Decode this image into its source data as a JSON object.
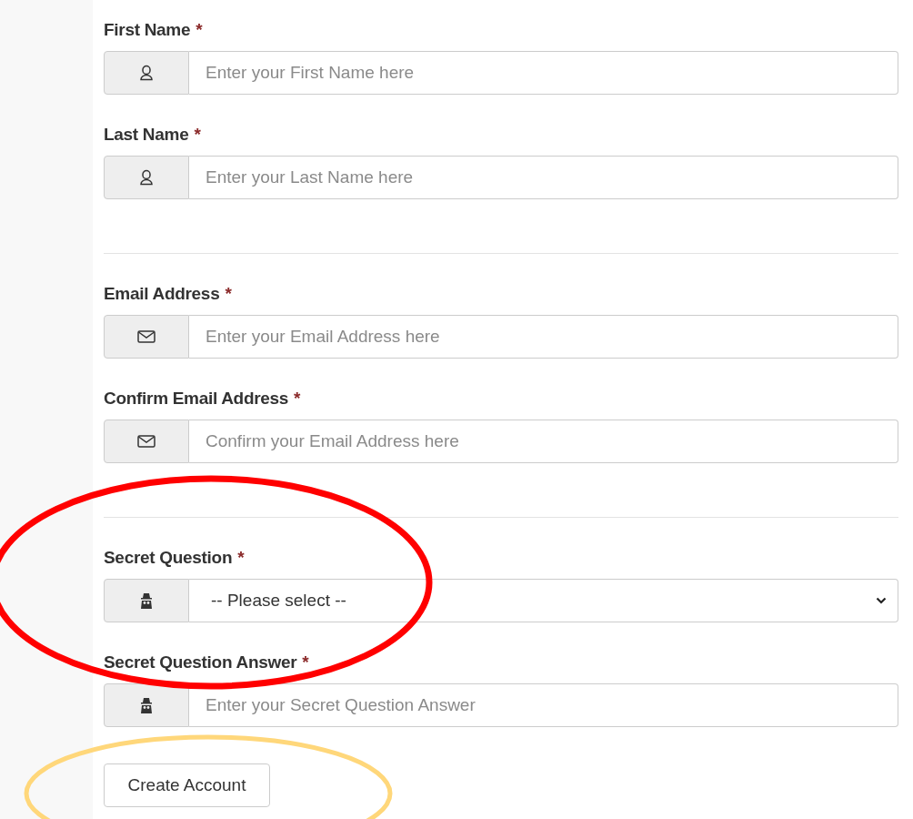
{
  "sections": [
    {
      "fields": [
        {
          "label": "First Name",
          "required": "*",
          "kind": "input",
          "placeholder": "Enter your First Name here"
        },
        {
          "label": "Last Name",
          "required": "*",
          "kind": "input",
          "placeholder": "Enter your Last Name here"
        }
      ]
    },
    {
      "fields": [
        {
          "label": "Email Address",
          "required": "*",
          "kind": "input",
          "placeholder": "Enter your Email Address here"
        },
        {
          "label": "Confirm Email Address",
          "required": "*",
          "kind": "input",
          "placeholder": "Confirm your Email Address here"
        }
      ]
    },
    {
      "fields": [
        {
          "label": "Secret Question",
          "required": "*",
          "kind": "select",
          "value": "-- Please select --"
        },
        {
          "label": "Secret Question Answer",
          "required": "*",
          "kind": "input",
          "placeholder": "Enter your Secret Question Answer"
        }
      ]
    }
  ],
  "submit": {
    "label": "Create Account"
  },
  "annotations": [
    {
      "kind": "ellipse",
      "color": "#ff0000"
    },
    {
      "kind": "ellipse",
      "color": "#ffd77a"
    }
  ]
}
